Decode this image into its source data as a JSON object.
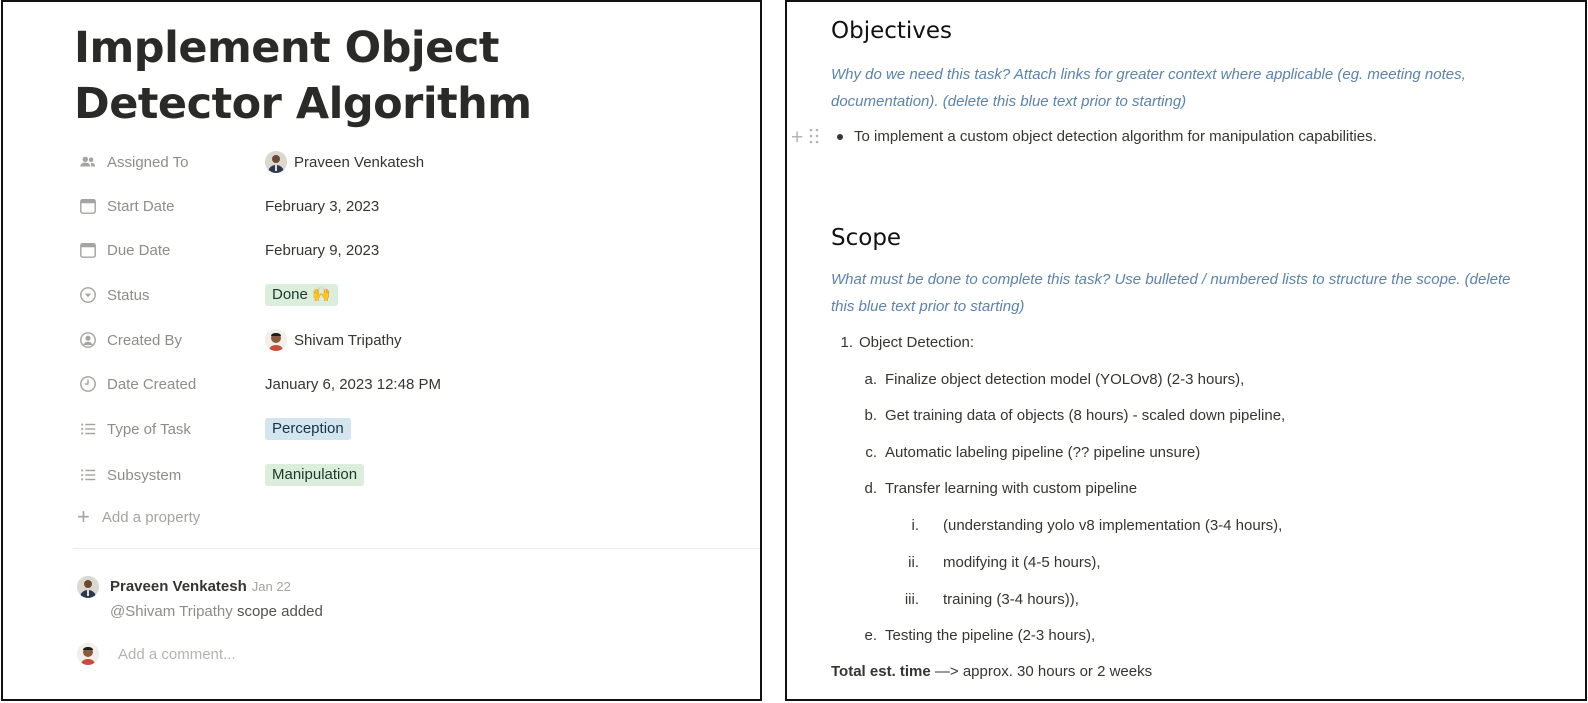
{
  "left": {
    "title": "Implement Object Detector Algorithm",
    "properties": [
      {
        "icon": "people-icon",
        "label": "Assigned To",
        "value": "Praveen Venkatesh",
        "type": "person"
      },
      {
        "icon": "calendar-icon",
        "label": "Start Date",
        "value": "February 3, 2023",
        "type": "text"
      },
      {
        "icon": "calendar-icon",
        "label": "Due Date",
        "value": "February 9, 2023",
        "type": "text"
      },
      {
        "icon": "status-icon",
        "label": "Status",
        "value": "Done 🙌",
        "type": "tag",
        "color": "#dbeddb"
      },
      {
        "icon": "person-circle-icon",
        "label": "Created By",
        "value": "Shivam Tripathy",
        "type": "person"
      },
      {
        "icon": "clock-icon",
        "label": "Date Created",
        "value": "January 6, 2023 12:48 PM",
        "type": "text"
      },
      {
        "icon": "list-icon",
        "label": "Type of Task",
        "value": "Perception",
        "type": "tag",
        "color": "#d3e5ef"
      },
      {
        "icon": "list-icon",
        "label": "Subsystem",
        "value": "Manipulation",
        "type": "tag",
        "color": "#dbeddb"
      }
    ],
    "add_property": "Add a property",
    "comment": {
      "author": "Praveen Venkatesh",
      "date": "Jan 22",
      "mention": "@Shivam Tripathy",
      "text": " scope added"
    },
    "add_comment_placeholder": "Add a comment..."
  },
  "right": {
    "objectives": {
      "heading": "Objectives",
      "instructions": "Why do we need this task? Attach links for greater context where applicable (eg. meeting notes, documentation). (delete this blue text prior to starting)",
      "bullet": "To implement a custom object detection algorithm for manipulation capabilities."
    },
    "scope": {
      "heading": "Scope",
      "instructions": "What must be done to complete this task? Use bulleted / numbered lists to structure the scope. (delete this blue text prior to starting)",
      "items": [
        {
          "marker": "1.",
          "text": "Object Detection:"
        },
        {
          "marker": "a.",
          "text": "Finalize object detection model (YOLOv8) (2-3 hours),"
        },
        {
          "marker": "b.",
          "text": "Get training data of objects (8 hours) - scaled down pipeline,"
        },
        {
          "marker": "c.",
          "text": "Automatic labeling pipeline (?? pipeline unsure)"
        },
        {
          "marker": "d.",
          "text": "Transfer learning with custom pipeline"
        },
        {
          "marker": "i.",
          "text": "(understanding yolo v8 implementation (3-4 hours),"
        },
        {
          "marker": "ii.",
          "text": "modifying it (4-5 hours),"
        },
        {
          "marker": "iii.",
          "text": "training (3-4 hours)),"
        },
        {
          "marker": "e.",
          "text": "Testing the pipeline (2-3 hours),"
        }
      ],
      "total_label": "Total est. time",
      "total_value": " —> approx. 30 hours or 2 weeks"
    }
  }
}
